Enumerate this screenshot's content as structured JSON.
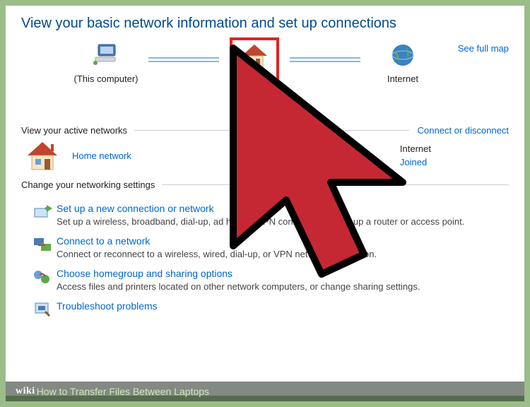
{
  "title": "View your basic network information and set up connections",
  "map": {
    "see_full_map": "See full map",
    "this_computer": "(This computer)",
    "internet": "Internet"
  },
  "active": {
    "heading": "View your active networks",
    "connect_link": "Connect or disconnect",
    "home_network": "Home network",
    "info_internet": "Internet",
    "info_joined": "Joined"
  },
  "settings": {
    "heading": "Change your networking settings",
    "opt1_link": "Set up a new connection or network",
    "opt1_desc": "Set up a wireless, broadband, dial-up, ad hoc, or VPN connection; or set up a router or access point.",
    "opt2_link": "Connect to a network",
    "opt2_desc": "Connect or reconnect to a wireless, wired, dial-up, or VPN network connection.",
    "opt3_link": "Choose homegroup and sharing options",
    "opt3_desc": "Access files and printers located on other network computers, or change sharing settings.",
    "opt4_link": "Troubleshoot problems"
  },
  "footer": {
    "brand": "wiki",
    "article": "How to Transfer Files Between Laptops"
  }
}
